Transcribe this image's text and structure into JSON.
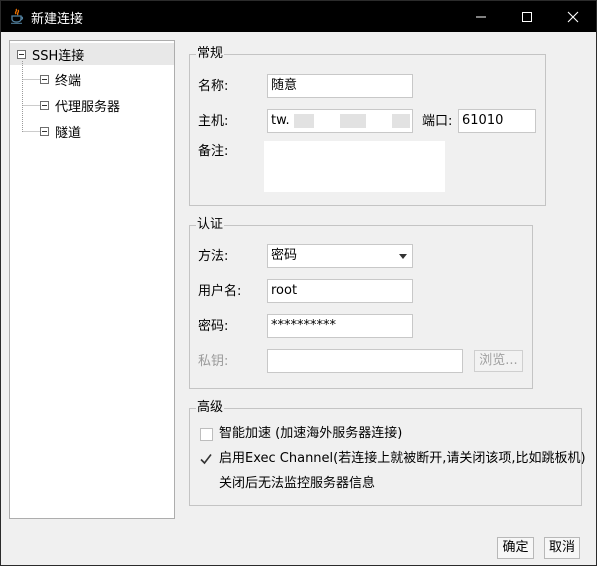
{
  "window": {
    "title": "新建连接",
    "icon": "java-cup-icon"
  },
  "tree": {
    "root": "SSH连接",
    "children": [
      "终端",
      "代理服务器",
      "隧道"
    ]
  },
  "general": {
    "legend": "常规",
    "name_label": "名称:",
    "name_value": "随意",
    "host_label": "主机:",
    "host_value": "tw.",
    "port_label": "端口:",
    "port_value": "61010",
    "note_label": "备注:",
    "note_value": ""
  },
  "auth": {
    "legend": "认证",
    "method_label": "方法:",
    "method_value": "密码",
    "user_label": "用户名:",
    "user_value": "root",
    "password_label": "密码:",
    "password_value": "**********",
    "key_label": "私钥:",
    "key_value": "",
    "browse_label": "浏览..."
  },
  "advanced": {
    "legend": "高级",
    "smart_accel_label": "智能加速 (加速海外服务器连接)",
    "smart_accel_checked": false,
    "exec_channel_label": "启用Exec Channel(若连接上就被断开,请关闭该项,比如跳板机)",
    "exec_channel_checked": true,
    "exec_channel_note": "关闭后无法监控服务器信息"
  },
  "footer": {
    "ok_label": "确定",
    "cancel_label": "取消"
  },
  "colors": {
    "titlebar": "#000000",
    "selection": "#e8e8e8",
    "panel": "#f0f0f0"
  }
}
